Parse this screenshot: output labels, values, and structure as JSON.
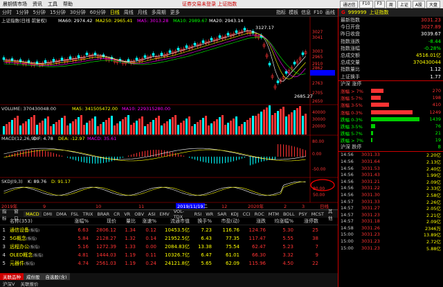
{
  "menu": {
    "items": [
      "分时",
      "1分钟",
      "5分钟",
      "15分钟",
      "30分钟",
      "60分钟",
      "日线",
      "周线",
      "月线",
      "多周期",
      "更多"
    ],
    "brand": "晨钥情市场",
    "file": "资讯",
    "tool": "工具",
    "help": "帮助",
    "alert": "证券交易未登录 上证指数",
    "btns": [
      "通达信",
      "F10",
      "F3",
      "周",
      "上证",
      "A股",
      "大盘"
    ]
  },
  "toolbar": {
    "tabs": [
      "分时",
      "1分钟",
      "5分钟",
      "15分钟",
      "30分钟",
      "60分钟",
      "日线",
      "周线",
      "月线",
      "多周期",
      "更多"
    ],
    "active": "日线",
    "right": [
      "指标",
      "模板",
      "信息",
      "F10",
      "画线"
    ]
  },
  "main": {
    "legend": {
      "name": "上证指数(日线 前复权)",
      "ma60": "MA60: 2974.42",
      "ma250": "MA250: 2965.41",
      "ma1": "MA5: 3013.28",
      "ma10": "MA10: 2989.67",
      "ma20": "MA20: 2943.14"
    },
    "price_labels": [
      "3027",
      "3041",
      "3003",
      "2965",
      "2910",
      "2862",
      "2816.8",
      "2763",
      "2705",
      "2650"
    ],
    "peak": "3127.17",
    "low": "2685.27",
    "vol_legend": {
      "name": "VOLUME: 370430048.00",
      "ma5": "MA5: 341505472.00",
      "ma10": "MA10: 229315280.00"
    },
    "vol_labels": [
      "40000",
      "30000",
      "20000"
    ],
    "macd_legend": {
      "name": "MACD(12,26,9)",
      "dif": "DIF: 4.78",
      "dea": "DEA: -12.97",
      "macd": "MACD: 35.61"
    },
    "macd_labels": [
      "80.00",
      "0.00",
      "-50.00"
    ],
    "kdj_legend": {
      "name": "SKDJ(9,3)",
      "k": "K: 89.76",
      "d": "D: 91.17"
    },
    "kdj_labels": [
      "80.00",
      "50.00"
    ],
    "dates": [
      "2019年",
      "9",
      "10",
      "11",
      "2019/11/19二",
      "12",
      "2020年",
      "2",
      "3",
      "日线"
    ]
  },
  "indicator_tabs": [
    "指标",
    "窗口",
    "MACD",
    "DMI",
    "DMA",
    "FSL",
    "TRIX",
    "BRAR",
    "CR",
    "VR",
    "OBV",
    "ASI",
    "EMV",
    "VOL-TDX",
    "RSI",
    "WR",
    "SAR",
    "KDJ",
    "CCI",
    "ROC",
    "MTM",
    "BOLL",
    "PSY",
    "MCST",
    "其他"
  ],
  "table": {
    "headers": [
      "名称(353)",
      "涨幅%",
      "现价",
      "量比",
      "涨速%",
      "流通市值",
      "换手%",
      "市盈(动)",
      "涨跌",
      "均涨幅%",
      "涨停数"
    ],
    "rows": [
      {
        "n": "1",
        "name": "通信设备",
        "tag": "(板指)",
        "chg": "6.63",
        "price": "2806.12",
        "vr": "1.34",
        "spd": "0.12",
        "mcap": "10453.5亿",
        "turn": "7.23",
        "pe": "116.76",
        "up": "124.76",
        "avg": "5.30",
        "lim": "25"
      },
      {
        "n": "2",
        "name": "5G概念",
        "tag": "(板指)",
        "chg": "5.84",
        "price": "2128.27",
        "vr": "1.32",
        "spd": "0.14",
        "mcap": "21952.5亿",
        "turn": "6.43",
        "pe": "77.35",
        "up": "117.47",
        "avg": "5.55",
        "lim": "38"
      },
      {
        "n": "3",
        "name": "远程办公",
        "tag": "(板指)",
        "chg": "5.16",
        "price": "1272.39",
        "vr": "1.33",
        "spd": "0.00",
        "mcap": "2084.83亿",
        "turn": "13.38",
        "pe": "75.54",
        "up": "62.47",
        "avg": "5.23",
        "lim": "7"
      },
      {
        "n": "4",
        "name": "OLED概念",
        "tag": "(板指)",
        "chg": "4.81",
        "price": "1444.03",
        "vr": "1.19",
        "spd": "0.11",
        "mcap": "10326.7亿",
        "turn": "6.47",
        "pe": "61.01",
        "up": "66.30",
        "avg": "3.32",
        "lim": "9"
      },
      {
        "n": "5",
        "name": "元器件",
        "tag": "(板指)",
        "chg": "4.74",
        "price": "2561.03",
        "vr": "1.19",
        "spd": "0.24",
        "mcap": "24121.8亿",
        "turn": "5.65",
        "pe": "62.09",
        "up": "115.96",
        "avg": "4.50",
        "lim": "22"
      }
    ]
  },
  "bottom_tabs": [
    "关联品种",
    "成份股",
    "自选股(含)"
  ],
  "status": [
    "沪深V",
    "关联报价"
  ],
  "right": {
    "g": "G",
    "code": "999999",
    "name": "上证指数",
    "stats": [
      {
        "l": "最新指数",
        "v": "3031.23",
        "c": "red"
      },
      {
        "l": "今日开盘",
        "v": "3027.89",
        "c": "red"
      },
      {
        "l": "昨日收盘",
        "v": "3039.67",
        "c": "white"
      },
      {
        "l": "指数涨跌",
        "v": "-8.44",
        "c": "green"
      },
      {
        "l": "指数涨幅",
        "v": "-0.28%",
        "c": "green"
      },
      {
        "l": "总成交额",
        "v": "4516.01亿",
        "c": "yellow"
      },
      {
        "l": "总成交量",
        "v": "370430044",
        "c": "yellow"
      },
      {
        "l": "指数量比",
        "v": "1.12",
        "c": "white"
      },
      {
        "l": "上证换手",
        "v": "1.77",
        "c": "white"
      }
    ],
    "updn_title": "沪深 涨停",
    "updn": [
      {
        "l": "涨幅 > 7%",
        "n": "270",
        "c": "red",
        "w": 18
      },
      {
        "l": "涨幅 5-7%",
        "n": "198",
        "c": "red",
        "w": 14
      },
      {
        "l": "涨幅 3-5%",
        "n": "410",
        "c": "red",
        "w": 26
      },
      {
        "l": "涨幅 0-3%",
        "n": "1249",
        "c": "red",
        "w": 60
      },
      {
        "l": "跌幅 0-3%",
        "n": "1439",
        "c": "green",
        "w": 70
      },
      {
        "l": "跌幅 3-5%",
        "n": "76",
        "c": "green",
        "w": 6
      },
      {
        "l": "跌幅 5-7%",
        "n": "21",
        "c": "green",
        "w": 3
      },
      {
        "l": "跌幅 > 7%",
        "n": "19",
        "c": "green",
        "w": 2
      }
    ],
    "limit_title": "沪深 跌停",
    "limit_n": "8",
    "ticks": [
      {
        "t": "14:56",
        "p": "3031.33",
        "v": "2.20亿"
      },
      {
        "t": "14:56",
        "p": "3031.64",
        "v": "2.13亿"
      },
      {
        "t": "14:56",
        "p": "3031.53",
        "v": "2.40亿"
      },
      {
        "t": "14:56",
        "p": "3031.43",
        "v": "1.99亿"
      },
      {
        "t": "14:56",
        "p": "3031.21",
        "v": "2.09亿"
      },
      {
        "t": "14:56",
        "p": "3031.22",
        "v": "2.33亿"
      },
      {
        "t": "14:56",
        "p": "3031.30",
        "v": "2.58亿"
      },
      {
        "t": "14:57",
        "p": "3031.33",
        "v": "2.26亿"
      },
      {
        "t": "14:57",
        "p": "3031.27",
        "v": "2.05亿"
      },
      {
        "t": "14:57",
        "p": "3031.23",
        "v": "2.21亿"
      },
      {
        "t": "14:57",
        "p": "3031.18",
        "v": "2.09亿"
      },
      {
        "t": "14:58",
        "p": "3031.26",
        "v": "2346万"
      },
      {
        "t": "15:00",
        "p": "3031.23",
        "v": "13.89亿"
      },
      {
        "t": "15:00",
        "p": "3031.23",
        "v": "2.72亿"
      },
      {
        "t": "15:00",
        "p": "3031.23",
        "v": "5.88亿"
      }
    ]
  },
  "colors": {
    "up": "#ff3333",
    "down": "#00ff00",
    "accent": "#ffff00"
  }
}
